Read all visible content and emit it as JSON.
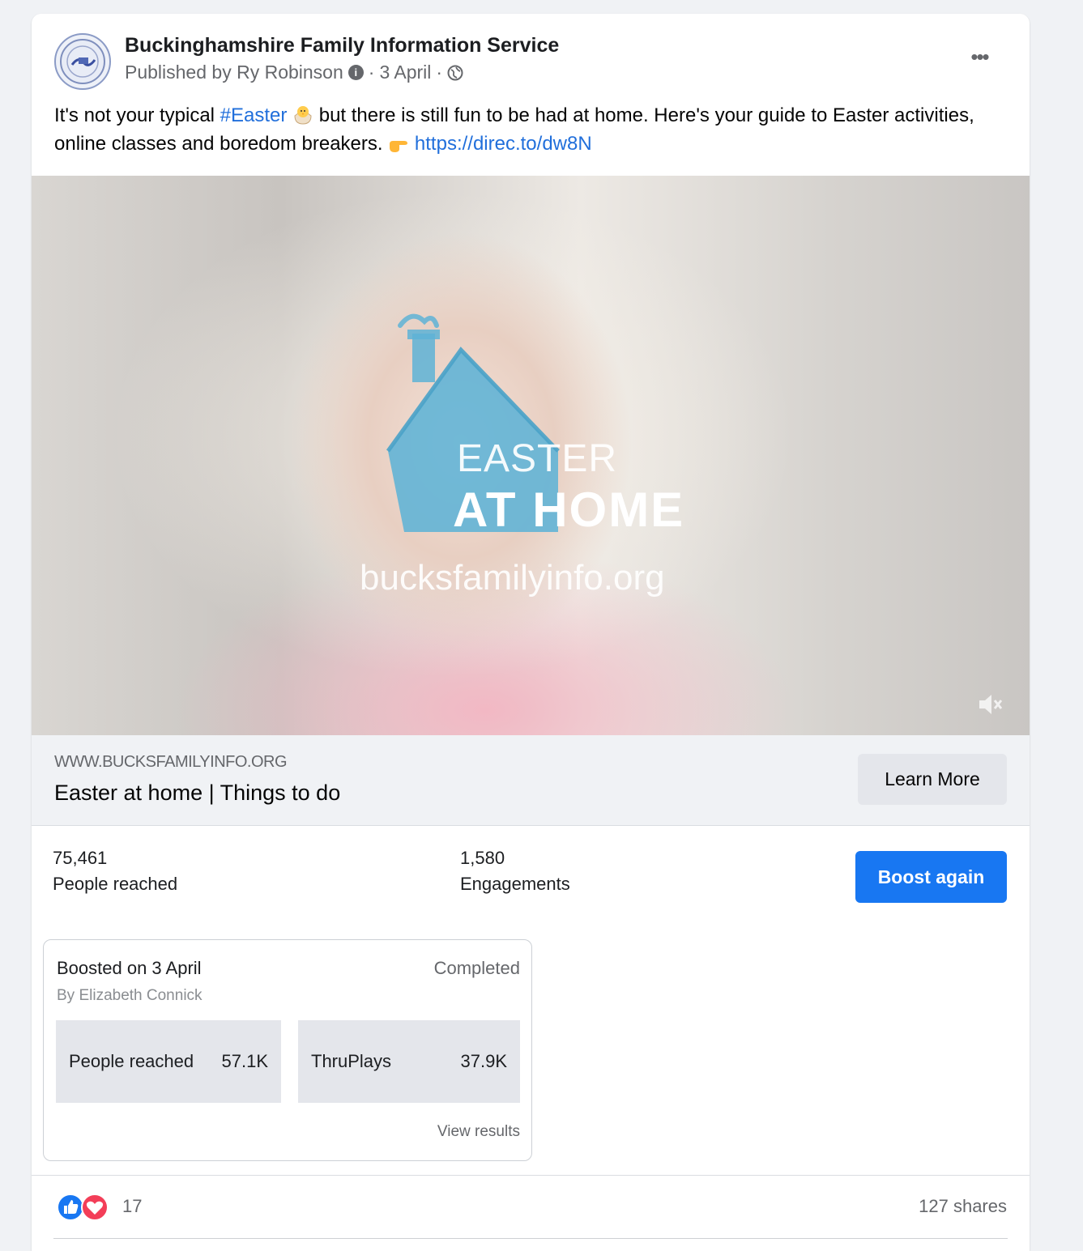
{
  "post": {
    "page_name": "Buckinghamshire Family Information Service",
    "published_by": "Published by Ry Robinson",
    "date": "3 April",
    "text_before_tag": "It's not your typical ",
    "hashtag": "#Easter",
    "text_after_tag": " but there is still fun to be had at home. Here's your guide to Easter activities, online classes and boredom breakers. ",
    "link": "https://direc.to/dw8N"
  },
  "video": {
    "line1": "EASTER",
    "line2": "AT HOME",
    "url": "bucksfamilyinfo.org",
    "house_color": "#5eb3d6"
  },
  "link_preview": {
    "domain": "WWW.BUCKSFAMILYINFO.ORG",
    "title": "Easter at home | Things to do",
    "cta": "Learn More"
  },
  "metrics": {
    "reached_value": "75,461",
    "reached_label": "People reached",
    "engagements_value": "1,580",
    "engagements_label": "Engagements",
    "boost_button": "Boost again"
  },
  "boost_summary": {
    "title": "Boosted on 3 April",
    "by": "By Elizabeth Connick",
    "status": "Completed",
    "stat1_label": "People reached",
    "stat1_value": "57.1K",
    "stat2_label": "ThruPlays",
    "stat2_value": "37.9K",
    "view_results": "View results"
  },
  "footer": {
    "reaction_count": "17",
    "shares": "127 shares"
  },
  "colors": {
    "accent": "#1877f2",
    "link": "#216fdb",
    "like": "#1877f2",
    "love": "#f33e58"
  },
  "icons": [
    "page-avatar-seal",
    "info-icon",
    "globe-icon",
    "more-icon",
    "hatching-chick-emoji",
    "pointing-hand-emoji",
    "house-logo",
    "mute-icon",
    "like-icon",
    "love-icon"
  ]
}
